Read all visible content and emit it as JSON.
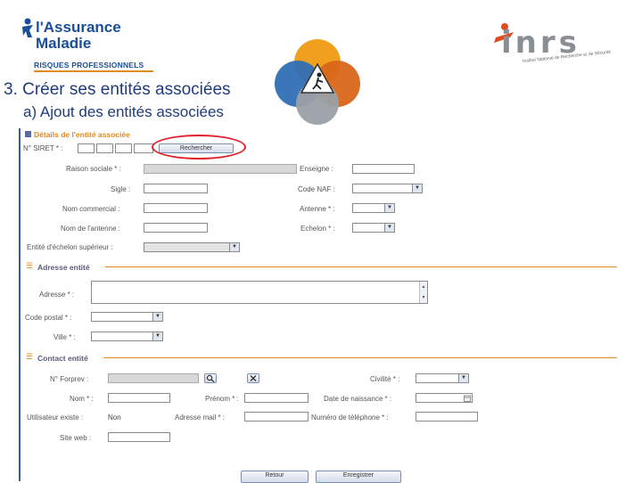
{
  "header": {
    "am_line1": "l'Assurance",
    "am_line2": "Maladie",
    "am_sub": "RISQUES PROFESSIONNELS",
    "inrs_logo": "inrs",
    "inrs_tagline": "Institut National de Recherche et de Sécurité",
    "slide_title": "3.  Créer ses entités associées",
    "slide_subtitle": "a)   Ajout des entités associées"
  },
  "form": {
    "details_title": "Détails de l'entité associée",
    "siret_label": "N° SIRET * :",
    "search_button": "Rechercher",
    "raison_sociale_label": "Raison sociale * :",
    "enseigne_label": "Enseigne :",
    "sigle_label": "Sigle :",
    "code_naf_label": "Code NAF :",
    "nom_commercial_label": "Nom commercial :",
    "antenne_label": "Antenne * :",
    "nom_antenne_label": "Nom de l'antenne :",
    "echelon_label": "Echelon * :",
    "entite_sup_label": "Entité d'échelon supérieur :",
    "adresse_section": "Adresse entité",
    "adresse_label": "Adresse * :",
    "code_postal_label": "Code postal * :",
    "ville_label": "Ville * :",
    "contact_section": "Contact entité",
    "forprev_label": "N° Forprev :",
    "civilite_label": "Civilité * :",
    "nom_label": "Nom * :",
    "prenom_label": "Prénom * :",
    "date_naissance_label": "Date de naissance * :",
    "utilisateur_label": "Utilisateur existe :",
    "utilisateur_value": "Non",
    "adresse_mail_label": "Adresse mail * :",
    "telephone_label": "Numéro de téléphone * :",
    "site_web_label": "Site web :",
    "retour_button": "Retour",
    "enregistrer_button": "Enregistrer"
  },
  "colors": {
    "title_blue": "#1f3c7a",
    "accent_orange": "#e08a1f",
    "highlight_red": "#e3202c"
  }
}
